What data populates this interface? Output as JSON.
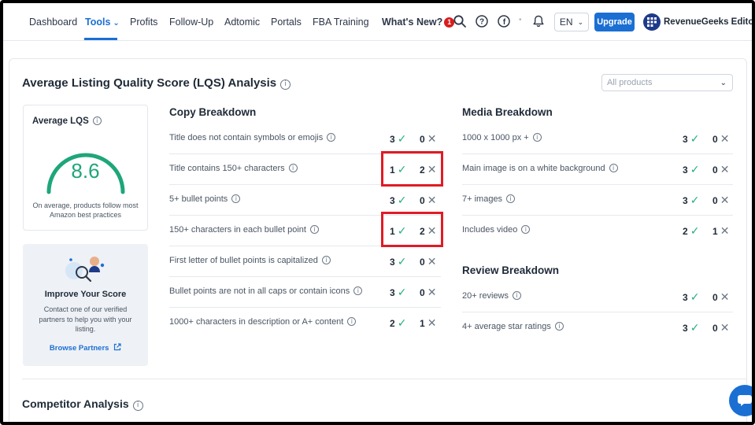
{
  "nav": {
    "items": [
      "Dashboard",
      "Tools",
      "Profits",
      "Follow-Up",
      "Adtomic",
      "Portals",
      "FBA Training"
    ],
    "whats_new": "What's New?",
    "whats_new_badge": "1",
    "language": "EN",
    "upgrade": "Upgrade",
    "profile_name": "RevenueGeeks Editorial"
  },
  "lqs": {
    "title": "Average Listing Quality Score (LQS) Analysis",
    "filter_value": "All products",
    "avg_label": "Average LQS",
    "avg_value": "8.6",
    "avg_desc": "On average, products follow most Amazon best practices"
  },
  "improve": {
    "title": "Improve Your Score",
    "desc": "Contact one of our verified partners to help you with your listing.",
    "link": "Browse Partners"
  },
  "copy": {
    "title": "Copy Breakdown",
    "rows": [
      {
        "label": "Title does not contain symbols or emojis",
        "pass": "3",
        "fail": "0"
      },
      {
        "label": "Title contains 150+ characters",
        "pass": "1",
        "fail": "2"
      },
      {
        "label": "5+ bullet points",
        "pass": "3",
        "fail": "0"
      },
      {
        "label": "150+ characters in each bullet point",
        "pass": "1",
        "fail": "2"
      },
      {
        "label": "First letter of bullet points is capitalized",
        "pass": "3",
        "fail": "0"
      },
      {
        "label": "Bullet points are not in all caps or contain icons",
        "pass": "3",
        "fail": "0"
      },
      {
        "label": "1000+ characters in description or A+ content",
        "pass": "2",
        "fail": "1"
      }
    ]
  },
  "media": {
    "title": "Media Breakdown",
    "rows": [
      {
        "label": "1000 x 1000 px +",
        "pass": "3",
        "fail": "0"
      },
      {
        "label": "Main image is on a white background",
        "pass": "3",
        "fail": "0"
      },
      {
        "label": "7+ images",
        "pass": "3",
        "fail": "0"
      },
      {
        "label": "Includes video",
        "pass": "2",
        "fail": "1"
      }
    ]
  },
  "review": {
    "title": "Review Breakdown",
    "rows": [
      {
        "label": "20+ reviews",
        "pass": "3",
        "fail": "0"
      },
      {
        "label": "4+ average star ratings",
        "pass": "3",
        "fail": "0"
      }
    ]
  },
  "competitor": {
    "title": "Competitor Analysis"
  },
  "colors": {
    "accent": "#1b6fd3",
    "pass": "#22b07d",
    "highlight": "#e01b24",
    "gauge": "#1ea67a"
  },
  "icons": [
    "search-icon",
    "help-icon",
    "facebook-icon",
    "bell-icon",
    "info-icon",
    "check-icon",
    "cross-icon",
    "external-link-icon",
    "chat-icon"
  ]
}
